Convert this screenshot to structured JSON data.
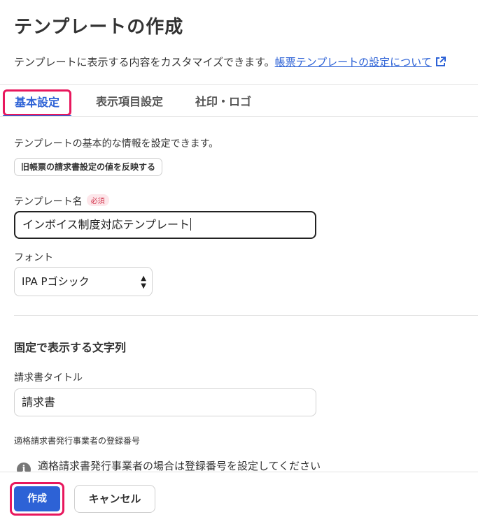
{
  "page": {
    "title": "テンプレートの作成",
    "description": "テンプレートに表示する内容をカスタマイズできます。",
    "help_link": "帳票テンプレートの設定について"
  },
  "tabs": [
    {
      "label": "基本設定",
      "active": true
    },
    {
      "label": "表示項目設定",
      "active": false
    },
    {
      "label": "社印・ロゴ",
      "active": false
    }
  ],
  "basic": {
    "description": "テンプレートの基本的な情報を設定できます。",
    "reflect_button": "旧帳票の請求書設定の値を反映する",
    "template_name_label": "テンプレート名",
    "required_badge": "必須",
    "template_name_value": "インボイス制度対応テンプレート",
    "font_label": "フォント",
    "font_value": "IPA Pゴシック"
  },
  "fixed_strings": {
    "heading": "固定で表示する文字列",
    "invoice_title_label": "請求書タイトル",
    "invoice_title_value": "請求書",
    "registration_label": "適格請求書発行事業者の登録番号",
    "registration_info": "適格請求書発行事業者の場合は登録番号を設定してください"
  },
  "footer": {
    "create_button": "作成",
    "cancel_button": "キャンセル"
  },
  "colors": {
    "accent": "#2d62d6",
    "highlight": "#e8175d"
  }
}
